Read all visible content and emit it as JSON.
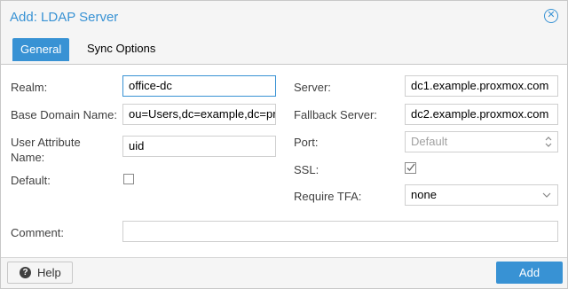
{
  "dialog": {
    "title": "Add: LDAP Server",
    "close_icon": "close-circle-icon"
  },
  "tabs": [
    {
      "label": "General",
      "active": true
    },
    {
      "label": "Sync Options",
      "active": false
    }
  ],
  "form": {
    "realm": {
      "label": "Realm:",
      "value": "office-dc"
    },
    "base_domain": {
      "label": "Base Domain Name:",
      "value": "ou=Users,dc=example,dc=proxmox"
    },
    "user_attr": {
      "label_line1": "User Attribute",
      "label_line2": "Name:",
      "value": "uid"
    },
    "default": {
      "label": "Default:",
      "checked": false
    },
    "server": {
      "label": "Server:",
      "value": "dc1.example.proxmox.com"
    },
    "fallback": {
      "label": "Fallback Server:",
      "value": "dc2.example.proxmox.com"
    },
    "port": {
      "label": "Port:",
      "placeholder": "Default"
    },
    "ssl": {
      "label": "SSL:",
      "checked": true
    },
    "tfa": {
      "label": "Require TFA:",
      "value": "none"
    },
    "comment": {
      "label": "Comment:",
      "value": ""
    }
  },
  "footer": {
    "help_label": "Help",
    "add_label": "Add"
  },
  "colors": {
    "accent": "#3892d4"
  }
}
